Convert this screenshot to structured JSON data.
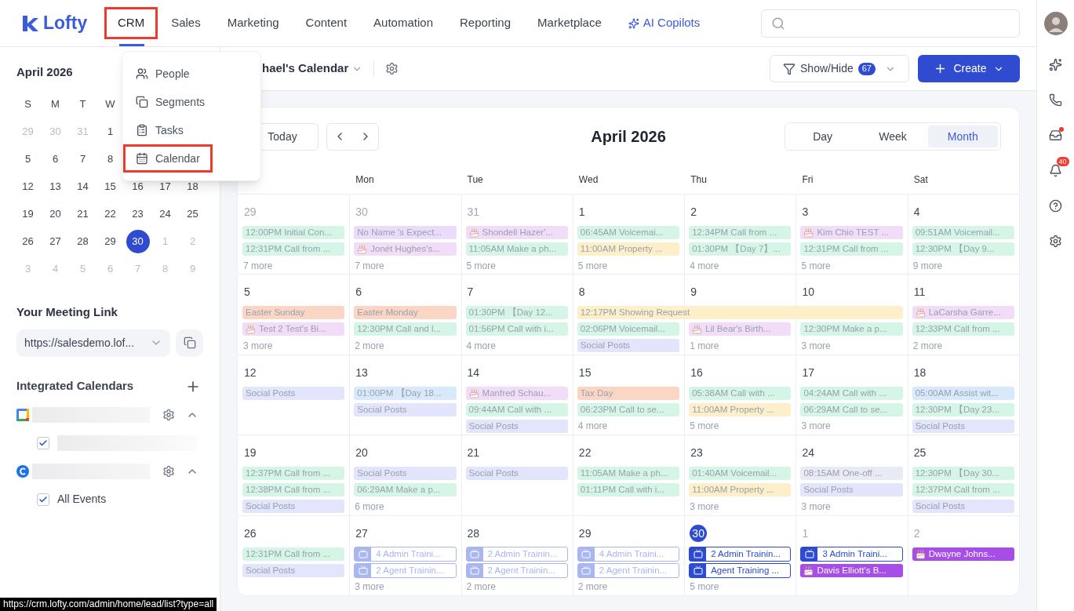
{
  "nav": {
    "logo": "Lofty",
    "items": [
      {
        "label": "CRM",
        "kind": "link",
        "selected": true,
        "highlighted": true
      },
      {
        "label": "Sales",
        "kind": "link",
        "selected": false,
        "highlighted": false
      },
      {
        "label": "Marketing",
        "kind": "link",
        "selected": false,
        "highlighted": false
      },
      {
        "label": "Content",
        "kind": "link",
        "selected": false,
        "highlighted": false
      },
      {
        "label": "Automation",
        "kind": "link",
        "selected": false,
        "highlighted": false
      },
      {
        "label": "Reporting",
        "kind": "link",
        "selected": false,
        "highlighted": false
      },
      {
        "label": "Marketplace",
        "kind": "link",
        "selected": false,
        "highlighted": false
      },
      {
        "label": "AI Copilots",
        "kind": "ai",
        "selected": false,
        "highlighted": false
      }
    ]
  },
  "crm_menu": {
    "items": [
      {
        "label": "People",
        "kind": "people",
        "highlighted": false
      },
      {
        "label": "Segments",
        "kind": "segments",
        "highlighted": false
      },
      {
        "label": "Tasks",
        "kind": "tasks",
        "highlighted": false
      },
      {
        "label": "Calendar",
        "kind": "calendar",
        "highlighted": true
      }
    ]
  },
  "mini_calendar": {
    "title": "April 2026",
    "weekdays": [
      "S",
      "M",
      "T",
      "W"
    ],
    "weeks": [
      [
        {
          "day": "29",
          "muted": true,
          "selected": false
        },
        {
          "day": "30",
          "muted": true,
          "selected": false
        },
        {
          "day": "31",
          "muted": true,
          "selected": false
        },
        {
          "day": "1",
          "muted": false,
          "selected": false
        }
      ],
      [
        {
          "day": "5",
          "muted": false,
          "selected": false
        },
        {
          "day": "6",
          "muted": false,
          "selected": false
        },
        {
          "day": "7",
          "muted": false,
          "selected": false
        },
        {
          "day": "8",
          "muted": false,
          "selected": false
        }
      ],
      [
        {
          "day": "12",
          "muted": false,
          "selected": false
        },
        {
          "day": "13",
          "muted": false,
          "selected": false
        },
        {
          "day": "14",
          "muted": false,
          "selected": false
        },
        {
          "day": "15",
          "muted": false,
          "selected": false
        },
        {
          "day": "16",
          "muted": false,
          "selected": false
        },
        {
          "day": "17",
          "muted": false,
          "selected": false
        },
        {
          "day": "18",
          "muted": false,
          "selected": false
        }
      ],
      [
        {
          "day": "19",
          "muted": false,
          "selected": false
        },
        {
          "day": "20",
          "muted": false,
          "selected": false
        },
        {
          "day": "21",
          "muted": false,
          "selected": false
        },
        {
          "day": "22",
          "muted": false,
          "selected": false
        },
        {
          "day": "23",
          "muted": false,
          "selected": false
        },
        {
          "day": "24",
          "muted": false,
          "selected": false
        },
        {
          "day": "25",
          "muted": false,
          "selected": false
        }
      ],
      [
        {
          "day": "26",
          "muted": false,
          "selected": false
        },
        {
          "day": "27",
          "muted": false,
          "selected": false
        },
        {
          "day": "28",
          "muted": false,
          "selected": false
        },
        {
          "day": "29",
          "muted": false,
          "selected": false
        },
        {
          "day": "30",
          "muted": false,
          "selected": true
        },
        {
          "day": "1",
          "muted": true,
          "selected": false
        },
        {
          "day": "2",
          "muted": true,
          "selected": false
        }
      ],
      [
        {
          "day": "3",
          "muted": true,
          "selected": false
        },
        {
          "day": "4",
          "muted": true,
          "selected": false
        },
        {
          "day": "5",
          "muted": true,
          "selected": false
        },
        {
          "day": "6",
          "muted": true,
          "selected": false
        },
        {
          "day": "7",
          "muted": true,
          "selected": false
        },
        {
          "day": "8",
          "muted": true,
          "selected": false
        },
        {
          "day": "9",
          "muted": true,
          "selected": false
        }
      ]
    ]
  },
  "meeting_link": {
    "title": "Your Meeting Link",
    "value": "https://salesdemo.lof..."
  },
  "integrated_calendars": {
    "title": "Integrated Calendars",
    "calendars": [
      {
        "kind": "google",
        "expanded": true,
        "children": [
          {
            "checked": true
          }
        ]
      },
      {
        "kind": "ring",
        "expanded": true,
        "children": [
          {
            "checked": true,
            "label": "All Events"
          }
        ]
      }
    ]
  },
  "toolbar": {
    "calendar_name": "hael's Calendar",
    "show_hide": {
      "label": "Show/Hide",
      "count": "67"
    },
    "create": "Create"
  },
  "calendar": {
    "today_button": "Today",
    "title": "April 2026",
    "views": [
      {
        "label": "Day",
        "selected": false
      },
      {
        "label": "Week",
        "selected": false
      },
      {
        "label": "Month",
        "selected": true
      }
    ],
    "weekdays": [
      "Mon",
      "Tue",
      "Wed",
      "Thu",
      "Fri",
      "Sat"
    ],
    "weeks": [
      {
        "days": [
          {
            "date": "29",
            "muted": true,
            "today": false,
            "events": [
              {
                "kind": "bar",
                "color": "#d5f5e6",
                "text": "12:00PM Initial Con..."
              },
              {
                "kind": "bar",
                "color": "#d5f5e6",
                "text": "12:31PM Call from ..."
              }
            ],
            "more": "7 more"
          },
          {
            "date": "30",
            "muted": true,
            "today": false,
            "events": [
              {
                "kind": "bar",
                "color": "#eadcfa",
                "text": "No Name 's Expect..."
              },
              {
                "kind": "birthday",
                "color": "#f1ddf8",
                "text": "Jonét Hughes's..."
              }
            ],
            "more": "7 more"
          },
          {
            "date": "31",
            "muted": true,
            "today": false,
            "events": [
              {
                "kind": "birthday",
                "color": "#f1ddf8",
                "text": "Shondell Hazer'..."
              },
              {
                "kind": "bar",
                "color": "#d5f5e6",
                "text": "11:05AM Make a ph..."
              }
            ],
            "more": "5 more"
          },
          {
            "date": "1",
            "muted": false,
            "today": false,
            "events": [
              {
                "kind": "bar",
                "color": "#d5f5e6",
                "text": "06:45AM Voicemai..."
              },
              {
                "kind": "bar",
                "color": "#fdefc9",
                "text": "11:00AM Property ..."
              }
            ],
            "more": "5 more"
          },
          {
            "date": "2",
            "muted": false,
            "today": false,
            "events": [
              {
                "kind": "bar",
                "color": "#d5f5e6",
                "text": "12:34PM Call from ..."
              },
              {
                "kind": "bar",
                "color": "#d5f5e6",
                "text": "01:30PM 【Day 7】..."
              }
            ],
            "more": "4 more"
          },
          {
            "date": "3",
            "muted": false,
            "today": false,
            "events": [
              {
                "kind": "birthday",
                "color": "#f1ddf8",
                "text": "Kim Chio TEST ..."
              },
              {
                "kind": "bar",
                "color": "#d5f5e6",
                "text": "12:31PM Call from ..."
              }
            ],
            "more": "5 more"
          },
          {
            "date": "4",
            "muted": false,
            "today": false,
            "events": [
              {
                "kind": "bar",
                "color": "#d5f5e6",
                "text": "09:51AM Voicemail..."
              },
              {
                "kind": "bar",
                "color": "#d5f5e6",
                "text": "12:30PM 【Day 9..."
              }
            ],
            "more": "9 more"
          }
        ]
      },
      {
        "spans": [
          {
            "text": "12:17PM Showing Request",
            "color": "#fdefc9",
            "covers": [
              false,
              false,
              false,
              true,
              true,
              true,
              false
            ]
          }
        ],
        "days": [
          {
            "date": "5",
            "muted": false,
            "today": false,
            "events": [
              {
                "kind": "bar",
                "color": "#fcd6c5",
                "text": "Easter Sunday"
              },
              {
                "kind": "birthday",
                "color": "#f1ddf8",
                "text": "Test 2 Test's Bi..."
              }
            ],
            "more": "3 more"
          },
          {
            "date": "6",
            "muted": false,
            "today": false,
            "events": [
              {
                "kind": "bar",
                "color": "#fcd6c5",
                "text": "Easter Monday"
              },
              {
                "kind": "bar",
                "color": "#d5f5e6",
                "text": "12:30PM Call and l..."
              }
            ],
            "more": "2 more"
          },
          {
            "date": "7",
            "muted": false,
            "today": false,
            "events": [
              {
                "kind": "bar",
                "color": "#d5f5e6",
                "text": "01:30PM 【Day 12..."
              },
              {
                "kind": "bar",
                "color": "#d5f5e6",
                "text": "01:56PM Call with i..."
              }
            ],
            "more": "4 more"
          },
          {
            "date": "8",
            "muted": false,
            "today": false,
            "events": [
              {
                "kind": "bar",
                "color": "#d5f5e6",
                "text": "02:06PM Voicemail..."
              },
              {
                "kind": "bar",
                "color": "#e2e5fb",
                "text": "Social Posts"
              }
            ]
          },
          {
            "date": "9",
            "muted": false,
            "today": false,
            "events": [
              {
                "kind": "birthday",
                "color": "#f1ddf8",
                "text": "Lil Bear's Birth..."
              }
            ],
            "more": "1 more"
          },
          {
            "date": "10",
            "muted": false,
            "today": false,
            "events": [
              {
                "kind": "bar",
                "color": "#d5f5e6",
                "text": "12:30PM Make a p..."
              }
            ],
            "more": "3 more"
          },
          {
            "date": "11",
            "muted": false,
            "today": false,
            "events": [
              {
                "kind": "birthday",
                "color": "#f1ddf8",
                "text": "LaCarsha Garre..."
              },
              {
                "kind": "bar",
                "color": "#d5f5e6",
                "text": "12:33PM Call from ..."
              }
            ],
            "more": "2 more"
          }
        ]
      },
      {
        "days": [
          {
            "date": "12",
            "muted": false,
            "today": false,
            "events": [
              {
                "kind": "bar",
                "color": "#e2e5fb",
                "text": "Social Posts"
              }
            ]
          },
          {
            "date": "13",
            "muted": false,
            "today": false,
            "events": [
              {
                "kind": "bar",
                "color": "#d8e9fc",
                "text": "01:00PM 【Day 18..."
              },
              {
                "kind": "bar",
                "color": "#e2e5fb",
                "text": "Social Posts"
              }
            ]
          },
          {
            "date": "14",
            "muted": false,
            "today": false,
            "events": [
              {
                "kind": "birthday",
                "color": "#f1ddf8",
                "text": "Manfred Schau..."
              },
              {
                "kind": "bar",
                "color": "#d5f5e6",
                "text": "09:44AM Call with ..."
              },
              {
                "kind": "bar",
                "color": "#e2e5fb",
                "text": "Social Posts"
              }
            ]
          },
          {
            "date": "15",
            "muted": false,
            "today": false,
            "events": [
              {
                "kind": "bar",
                "color": "#fcd6c5",
                "text": "Tax Day"
              },
              {
                "kind": "bar",
                "color": "#d5f5e6",
                "text": "06:23PM Call to se..."
              }
            ],
            "more": "4 more"
          },
          {
            "date": "16",
            "muted": false,
            "today": false,
            "events": [
              {
                "kind": "bar",
                "color": "#d5f5e6",
                "text": "05:38AM Call with ..."
              },
              {
                "kind": "bar",
                "color": "#fdefc9",
                "text": "11:00AM Property ..."
              }
            ],
            "more": "5 more"
          },
          {
            "date": "17",
            "muted": false,
            "today": false,
            "events": [
              {
                "kind": "bar",
                "color": "#d5f5e6",
                "text": "04:24AM Call with ..."
              },
              {
                "kind": "bar",
                "color": "#d5f5e6",
                "text": "06:29AM Call to se..."
              }
            ],
            "more": "3 more"
          },
          {
            "date": "18",
            "muted": false,
            "today": false,
            "events": [
              {
                "kind": "bar",
                "color": "#d8e9fc",
                "text": "05:00AM Assist wit..."
              },
              {
                "kind": "bar",
                "color": "#d5f5e6",
                "text": "12:30PM 【Day 23..."
              },
              {
                "kind": "bar",
                "color": "#e2e5fb",
                "text": "Social Posts"
              }
            ]
          }
        ]
      },
      {
        "days": [
          {
            "date": "19",
            "muted": false,
            "today": false,
            "events": [
              {
                "kind": "bar",
                "color": "#d5f5e6",
                "text": "12:37PM Call from ..."
              },
              {
                "kind": "bar",
                "color": "#d5f5e6",
                "text": "12:38PM Call from ..."
              },
              {
                "kind": "bar",
                "color": "#e2e5fb",
                "text": "Social Posts"
              }
            ]
          },
          {
            "date": "20",
            "muted": false,
            "today": false,
            "events": [
              {
                "kind": "bar",
                "color": "#e2e5fb",
                "text": "Social Posts"
              },
              {
                "kind": "bar",
                "color": "#d5f5e6",
                "text": "06:29AM Make a p..."
              }
            ],
            "more": "6 more"
          },
          {
            "date": "21",
            "muted": false,
            "today": false,
            "events": [
              {
                "kind": "bar",
                "color": "#e2e5fb",
                "text": "Social Posts"
              }
            ]
          },
          {
            "date": "22",
            "muted": false,
            "today": false,
            "events": [
              {
                "kind": "bar",
                "color": "#d5f5e6",
                "text": "11:05AM Make a ph..."
              },
              {
                "kind": "bar",
                "color": "#d5f5e6",
                "text": "01:11PM Call with i..."
              }
            ]
          },
          {
            "date": "23",
            "muted": false,
            "today": false,
            "events": [
              {
                "kind": "bar",
                "color": "#d5f5e6",
                "text": "01:40AM Voicemail..."
              },
              {
                "kind": "bar",
                "color": "#fdefc9",
                "text": "11:00AM Property ..."
              }
            ],
            "more": "3 more"
          },
          {
            "date": "24",
            "muted": false,
            "today": false,
            "events": [
              {
                "kind": "bar",
                "color": "#e8ebf4",
                "text": "08:15AM One-off ..."
              },
              {
                "kind": "bar",
                "color": "#e2e5fb",
                "text": "Social Posts"
              }
            ],
            "more": "3 more"
          },
          {
            "date": "25",
            "muted": false,
            "today": false,
            "events": [
              {
                "kind": "bar",
                "color": "#d5f5e6",
                "text": "12:30PM 【Day 30..."
              },
              {
                "kind": "bar",
                "color": "#d5f5e6",
                "text": "12:37PM Call from ..."
              },
              {
                "kind": "bar",
                "color": "#e2e5fb",
                "text": "Social Posts"
              }
            ]
          }
        ]
      },
      {
        "days": [
          {
            "date": "26",
            "muted": false,
            "today": false,
            "events": [
              {
                "kind": "bar",
                "color": "#d5f5e6",
                "text": "12:31PM Call from ..."
              },
              {
                "kind": "bar",
                "color": "#e2e5fb",
                "text": "Social Posts"
              }
            ]
          },
          {
            "date": "27",
            "muted": false,
            "today": false,
            "events": [
              {
                "kind": "training",
                "color": "#a9b6ef",
                "text": "4 Admin Traini..."
              },
              {
                "kind": "training",
                "color": "#a9b6ef",
                "text": "2 Agent Trainin..."
              }
            ],
            "more": "3 more"
          },
          {
            "date": "28",
            "muted": false,
            "today": false,
            "events": [
              {
                "kind": "training",
                "color": "#a9b6ef",
                "text": "2 Admin Trainin..."
              },
              {
                "kind": "training",
                "color": "#a9b6ef",
                "text": "2 Agent Trainin..."
              }
            ],
            "more": "2 more"
          },
          {
            "date": "29",
            "muted": false,
            "today": false,
            "events": [
              {
                "kind": "training",
                "color": "#a9b6ef",
                "text": "4 Admin Traini..."
              },
              {
                "kind": "training",
                "color": "#a9b6ef",
                "text": "2 Agent Trainin..."
              }
            ],
            "more": "2 more"
          },
          {
            "date": "30",
            "muted": false,
            "today": true,
            "events": [
              {
                "kind": "training",
                "color": "#2d4ad0",
                "text": "2 Admin Trainin..."
              },
              {
                "kind": "training",
                "color": "#2d4ad0",
                "text": "Agent Training ..."
              }
            ],
            "more": "5 more"
          },
          {
            "date": "1",
            "muted": true,
            "today": false,
            "events": [
              {
                "kind": "training",
                "color": "#2d4ad0",
                "text": "3 Admin Traini..."
              },
              {
                "kind": "birthday",
                "color": "#a64ee6",
                "text": "Davis Elliott's B..."
              }
            ]
          },
          {
            "date": "2",
            "muted": true,
            "today": false,
            "events": [
              {
                "kind": "birthday",
                "color": "#a64ee6",
                "text": "Dwayne Johns..."
              }
            ]
          }
        ]
      }
    ]
  },
  "rail": [
    {
      "kind": "sparkle",
      "dot": false
    },
    {
      "kind": "phone",
      "dot": false
    },
    {
      "kind": "inbox",
      "dot": true
    },
    {
      "kind": "bell",
      "dot": false,
      "badge": "40"
    },
    {
      "kind": "help",
      "dot": false
    },
    {
      "kind": "settings",
      "dot": false
    }
  ],
  "status_url": "https://crm.lofty.com/admin/home/lead/list?type=all"
}
